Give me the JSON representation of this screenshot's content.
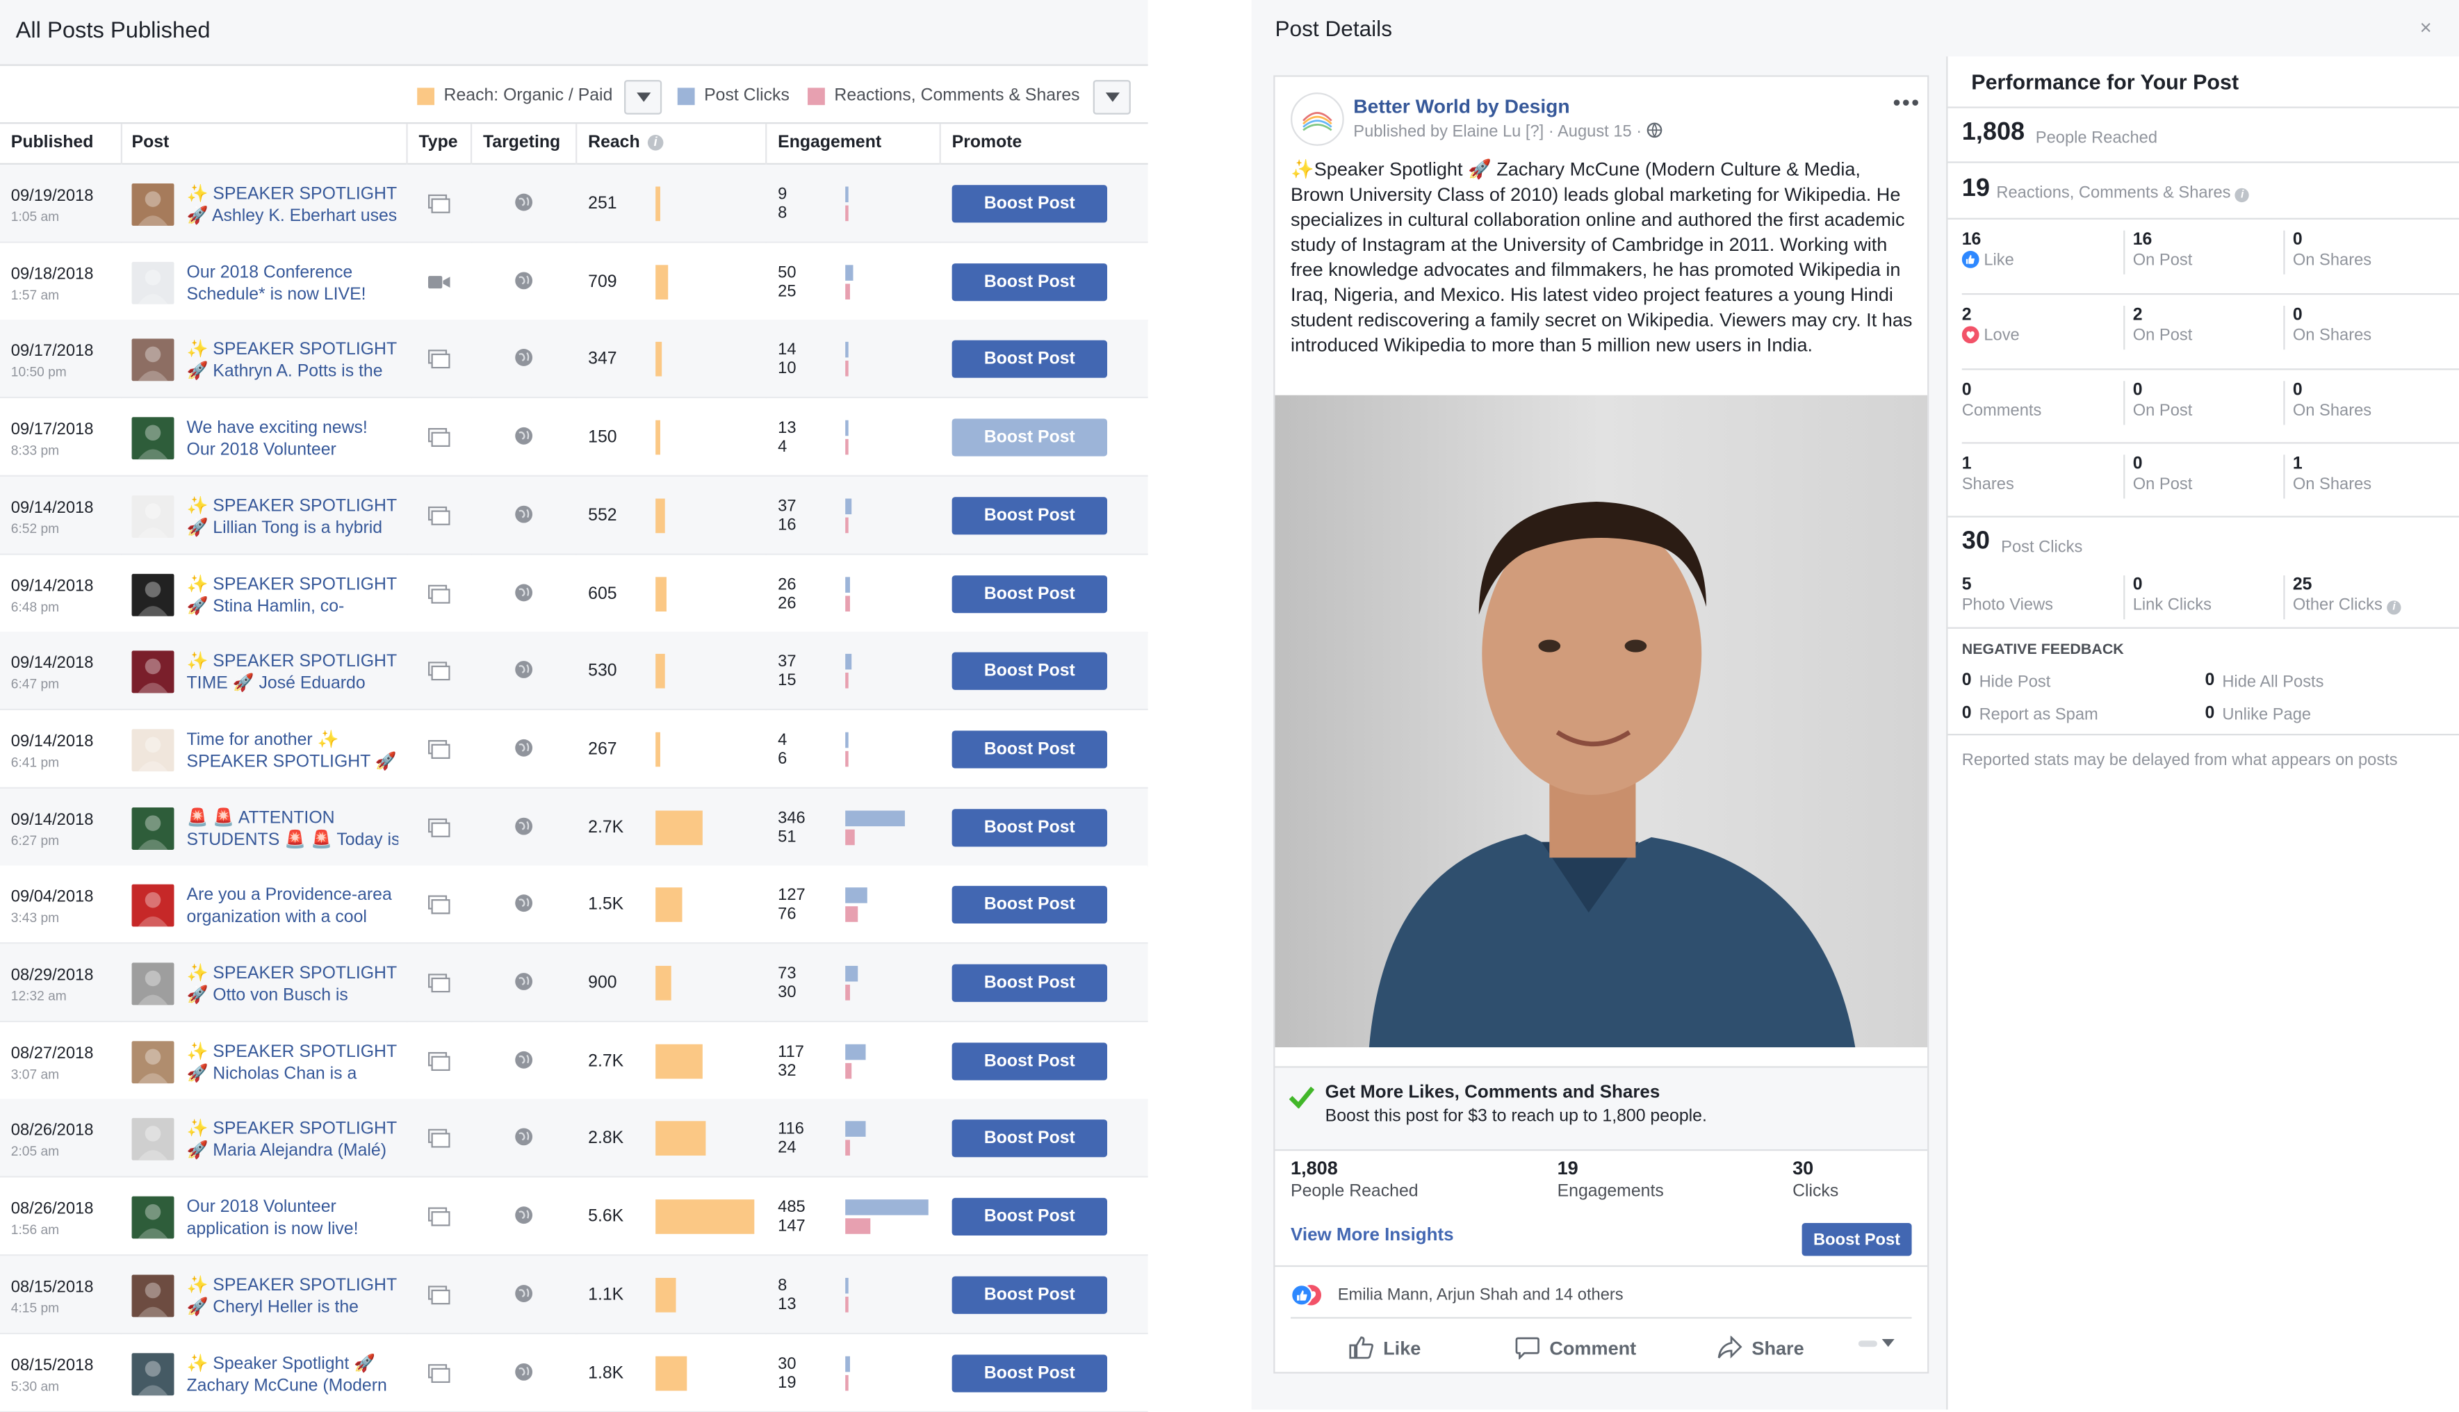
{
  "left": {
    "title": "All Posts Published",
    "legend": {
      "reach": "Reach: Organic / Paid",
      "clicks": "Post Clicks",
      "reactions": "Reactions, Comments & Shares"
    },
    "colors": {
      "reach": "#fbc885",
      "clicks": "#9cb4d8",
      "reactions": "#e7a0b0",
      "boost": "#4267b2",
      "link": "#365899"
    },
    "columns": [
      "Published",
      "Post",
      "Type",
      "Targeting",
      "Reach",
      "Engagement",
      "Promote"
    ],
    "boost_label": "Boost Post",
    "rows": [
      {
        "date": "09/19/2018",
        "time": "1:05 am",
        "post": "✨ SPEAKER SPOTLIGHT\n🚀 Ashley K. Eberhart uses",
        "type": "photo",
        "reach": "251",
        "reach_frac": 0.05,
        "clicks": "9",
        "reactions": "8",
        "clicks_frac": 0.02,
        "react_frac": 0.02,
        "thumb": "#a67b5b",
        "boost_enabled": true
      },
      {
        "date": "09/18/2018",
        "time": "1:57 am",
        "post": "Our 2018 Conference\nSchedule* is now LIVE!",
        "type": "video",
        "reach": "709",
        "reach_frac": 0.13,
        "clicks": "50",
        "reactions": "25",
        "clicks_frac": 0.1,
        "react_frac": 0.05,
        "thumb": "#e9ebee",
        "boost_enabled": true
      },
      {
        "date": "09/17/2018",
        "time": "10:50 pm",
        "post": "✨ SPEAKER SPOTLIGHT\n🚀 Kathryn A. Potts is the",
        "type": "photo",
        "reach": "347",
        "reach_frac": 0.06,
        "clicks": "14",
        "reactions": "10",
        "clicks_frac": 0.03,
        "react_frac": 0.02,
        "thumb": "#8d6e63",
        "boost_enabled": true
      },
      {
        "date": "09/17/2018",
        "time": "8:33 pm",
        "post": "We have exciting news!\nOur 2018 Volunteer",
        "type": "photo",
        "reach": "150",
        "reach_frac": 0.03,
        "clicks": "13",
        "reactions": "4",
        "clicks_frac": 0.03,
        "react_frac": 0.01,
        "thumb": "#2e5d3a",
        "boost_enabled": false
      },
      {
        "date": "09/14/2018",
        "time": "6:52 pm",
        "post": "✨ SPEAKER SPOTLIGHT\n🚀 Lillian Tong is a hybrid",
        "type": "photo",
        "reach": "552",
        "reach_frac": 0.1,
        "clicks": "37",
        "reactions": "16",
        "clicks_frac": 0.08,
        "react_frac": 0.03,
        "thumb": "#eeeeee",
        "boost_enabled": true
      },
      {
        "date": "09/14/2018",
        "time": "6:48 pm",
        "post": "✨ SPEAKER SPOTLIGHT\n🚀 Stina Hamlin, co-",
        "type": "photo",
        "reach": "605",
        "reach_frac": 0.11,
        "clicks": "26",
        "reactions": "26",
        "clicks_frac": 0.05,
        "react_frac": 0.05,
        "thumb": "#222222",
        "boost_enabled": true
      },
      {
        "date": "09/14/2018",
        "time": "6:47 pm",
        "post": "✨ SPEAKER SPOTLIGHT\nTIME 🚀 José Eduardo",
        "type": "photo",
        "reach": "530",
        "reach_frac": 0.1,
        "clicks": "37",
        "reactions": "15",
        "clicks_frac": 0.08,
        "react_frac": 0.03,
        "thumb": "#7a1f2b",
        "boost_enabled": true
      },
      {
        "date": "09/14/2018",
        "time": "6:41 pm",
        "post": "Time for another ✨\nSPEAKER SPOTLIGHT 🚀",
        "type": "photo",
        "reach": "267",
        "reach_frac": 0.05,
        "clicks": "4",
        "reactions": "6",
        "clicks_frac": 0.01,
        "react_frac": 0.01,
        "thumb": "#f0e6dc",
        "boost_enabled": true
      },
      {
        "date": "09/14/2018",
        "time": "6:27 pm",
        "post": "🚨 🚨 ATTENTION\nSTUDENTS 🚨 🚨 Today is",
        "type": "photo",
        "reach": "2.7K",
        "reach_frac": 0.48,
        "clicks": "346",
        "reactions": "51",
        "clicks_frac": 0.71,
        "react_frac": 0.11,
        "thumb": "#2e5d3a",
        "boost_enabled": true
      },
      {
        "date": "09/04/2018",
        "time": "3:43 pm",
        "post": "Are you a Providence-area\norganization with a cool",
        "type": "photo",
        "reach": "1.5K",
        "reach_frac": 0.27,
        "clicks": "127",
        "reactions": "76",
        "clicks_frac": 0.26,
        "react_frac": 0.16,
        "thumb": "#c62828",
        "boost_enabled": true
      },
      {
        "date": "08/29/2018",
        "time": "12:32 am",
        "post": "✨ SPEAKER SPOTLIGHT\n🚀 Otto von Busch is",
        "type": "photo",
        "reach": "900",
        "reach_frac": 0.16,
        "clicks": "73",
        "reactions": "30",
        "clicks_frac": 0.15,
        "react_frac": 0.06,
        "thumb": "#9e9e9e",
        "boost_enabled": true
      },
      {
        "date": "08/27/2018",
        "time": "3:07 am",
        "post": "✨ SPEAKER SPOTLIGHT\n🚀 Nicholas Chan is a",
        "type": "photo",
        "reach": "2.7K",
        "reach_frac": 0.48,
        "clicks": "117",
        "reactions": "32",
        "clicks_frac": 0.24,
        "react_frac": 0.07,
        "thumb": "#b08d6e",
        "boost_enabled": true
      },
      {
        "date": "08/26/2018",
        "time": "2:05 am",
        "post": "✨ SPEAKER SPOTLIGHT\n🚀 Maria Alejandra (Malé)",
        "type": "photo",
        "reach": "2.8K",
        "reach_frac": 0.5,
        "clicks": "116",
        "reactions": "24",
        "clicks_frac": 0.24,
        "react_frac": 0.05,
        "thumb": "#cfcfcf",
        "boost_enabled": true
      },
      {
        "date": "08/26/2018",
        "time": "1:56 am",
        "post": "Our 2018 Volunteer\napplication is now live!",
        "type": "photo",
        "reach": "5.6K",
        "reach_frac": 1.0,
        "clicks": "485",
        "reactions": "147",
        "clicks_frac": 1.0,
        "react_frac": 0.3,
        "thumb": "#2e5d3a",
        "boost_enabled": true
      },
      {
        "date": "08/15/2018",
        "time": "4:15 pm",
        "post": "✨ SPEAKER SPOTLIGHT\n🚀 Cheryl Heller is the",
        "type": "photo",
        "reach": "1.1K",
        "reach_frac": 0.2,
        "clicks": "8",
        "reactions": "13",
        "clicks_frac": 0.02,
        "react_frac": 0.03,
        "thumb": "#6d4c41",
        "boost_enabled": true
      },
      {
        "date": "08/15/2018",
        "time": "5:30 am",
        "post": "✨ Speaker Spotlight 🚀\nZachary McCune (Modern",
        "type": "photo",
        "reach": "1.8K",
        "reach_frac": 0.32,
        "clicks": "30",
        "reactions": "19",
        "clicks_frac": 0.06,
        "react_frac": 0.04,
        "thumb": "#455a64",
        "boost_enabled": true
      }
    ]
  },
  "details": {
    "title": "Post Details",
    "close": "×",
    "post": {
      "page_name": "Better World by Design",
      "logo_text": "BetterWorld by Design",
      "published": "Published by Elaine Lu [?] · August 15 ·",
      "more": "•••",
      "body": "✨Speaker Spotlight 🚀 Zachary McCune (Modern Culture & Media, Brown University Class of 2010) leads global marketing for Wikipedia. He specializes in cultural collaboration online and authored the first academic study of Instagram at the University of Cambridge in 2011. Working with free knowledge advocates and filmmakers, he has promoted Wikipedia in Iraq, Nigeria, and Mexico. His latest video project features a young Hindi student rediscovering a family secret on Wikipedia. Viewers may cry. It has introduced Wikipedia to more than 5 million new users in India.",
      "promo_heading": "Get More Likes, Comments and Shares",
      "promo_sub": "Boost this post for $3 to reach up to 1,800 people.",
      "stats": [
        {
          "value": "1,808",
          "label": "People Reached"
        },
        {
          "value": "19",
          "label": "Engagements"
        },
        {
          "value": "30",
          "label": "Clicks"
        }
      ],
      "view_insights": "View More Insights",
      "boost": "Boost Post",
      "reactors": "Emilia Mann, Arjun Shah and 14 others",
      "actions": {
        "like": "Like",
        "comment": "Comment",
        "share": "Share"
      }
    },
    "performance": {
      "title": "Performance for Your Post",
      "reached": {
        "value": "1,808",
        "label": "People Reached"
      },
      "engagement": {
        "value": "19",
        "label": "Reactions, Comments & Shares"
      },
      "grid": [
        [
          {
            "v": "16",
            "l": "Like"
          },
          {
            "v": "16",
            "l": "On Post"
          },
          {
            "v": "0",
            "l": "On Shares"
          }
        ],
        [
          {
            "v": "2",
            "l": "Love"
          },
          {
            "v": "2",
            "l": "On Post"
          },
          {
            "v": "0",
            "l": "On Shares"
          }
        ],
        [
          {
            "v": "0",
            "l": "Comments"
          },
          {
            "v": "0",
            "l": "On Post"
          },
          {
            "v": "0",
            "l": "On Shares"
          }
        ],
        [
          {
            "v": "1",
            "l": "Shares"
          },
          {
            "v": "0",
            "l": "On Post"
          },
          {
            "v": "1",
            "l": "On Shares"
          }
        ]
      ],
      "clicks": {
        "value": "30",
        "label": "Post Clicks"
      },
      "clicks_grid": [
        {
          "v": "5",
          "l": "Photo Views"
        },
        {
          "v": "0",
          "l": "Link Clicks"
        },
        {
          "v": "25",
          "l": "Other Clicks"
        }
      ],
      "negative_heading": "NEGATIVE FEEDBACK",
      "negative": [
        {
          "v": "0",
          "l": "Hide Post"
        },
        {
          "v": "0",
          "l": "Hide All Posts"
        },
        {
          "v": "0",
          "l": "Report as Spam"
        },
        {
          "v": "0",
          "l": "Unlike Page"
        }
      ],
      "note": "Reported stats may be delayed from what appears on posts"
    }
  }
}
